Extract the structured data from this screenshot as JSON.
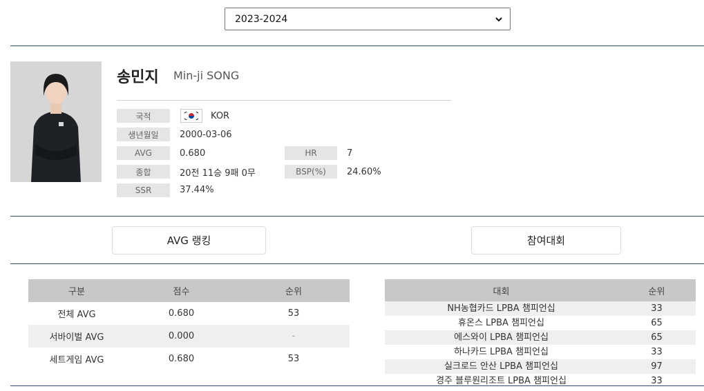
{
  "season": {
    "selected": "2023-2024"
  },
  "player": {
    "name_ko": "송민지",
    "name_en": "Min-ji SONG",
    "labels": {
      "nationality": "국적",
      "birth": "생년월일",
      "avg": "AVG",
      "hr": "HR",
      "record": "종합",
      "bsp": "BSP(%)",
      "ssr": "SSR"
    },
    "values": {
      "nationality": "KOR",
      "birth": "2000-03-06",
      "avg": "0.680",
      "hr": "7",
      "record": "20전 11승 9패 0무",
      "bsp": "24.60%",
      "ssr": "37.44%"
    }
  },
  "tabs": {
    "avg_ranking": "AVG 랭킹",
    "tournaments": "참여대회"
  },
  "avg_table": {
    "headers": [
      "구분",
      "점수",
      "순위"
    ],
    "rows": [
      {
        "category": "전체 AVG",
        "score": "0.680",
        "rank": "53"
      },
      {
        "category": "서바이벌 AVG",
        "score": "0.000",
        "rank": "-"
      },
      {
        "category": "세트게임 AVG",
        "score": "0.680",
        "rank": "53"
      }
    ]
  },
  "tournament_table": {
    "headers": [
      "대회",
      "순위"
    ],
    "rows": [
      {
        "name": "NH농협카드 LPBA 챔피언십",
        "rank": "33"
      },
      {
        "name": "휴온스 LPBA 챔피언십",
        "rank": "65"
      },
      {
        "name": "에스와이 LPBA 챔피언십",
        "rank": "65"
      },
      {
        "name": "하나카드 LPBA 챔피언십",
        "rank": "33"
      },
      {
        "name": "실크로드 안산 LPBA 챔피언십",
        "rank": "97"
      },
      {
        "name": "경주 블루원리조트 LPBA 챔피언십",
        "rank": "33"
      }
    ]
  },
  "colors": {
    "rule": "#2b4a6b",
    "header_bg": "#c8c8c8",
    "label_bg": "#e5e5e5",
    "stripe": "#efefef"
  }
}
